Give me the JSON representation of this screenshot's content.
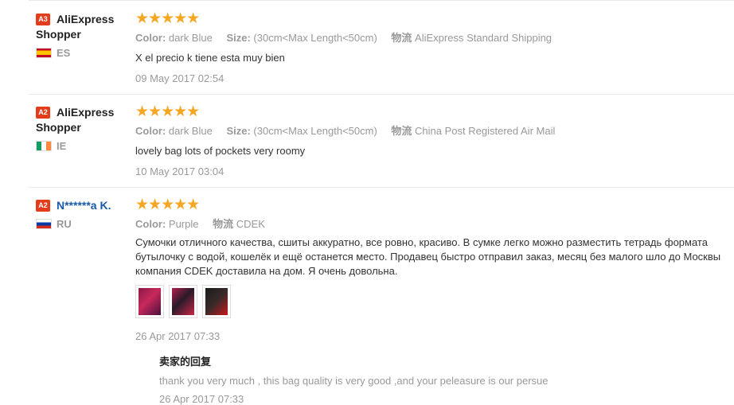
{
  "reviews": [
    {
      "level": "A3",
      "user_name": "AliExpress Shopper",
      "country_code": "ES",
      "stars": "★★★★★",
      "color_label": "Color:",
      "color_value": "dark Blue",
      "size_label": "Size:",
      "size_value": "(30cm<Max Length<50cm)",
      "logistics_label": "物流",
      "logistics_value": "AliExpress Standard Shipping",
      "text": "X el precio k tiene esta muy bien",
      "date": "09 May 2017 02:54"
    },
    {
      "level": "A2",
      "user_name": "AliExpress Shopper",
      "country_code": "IE",
      "stars": "★★★★★",
      "color_label": "Color:",
      "color_value": "dark Blue",
      "size_label": "Size:",
      "size_value": "(30cm<Max Length<50cm)",
      "logistics_label": "物流",
      "logistics_value": "China Post Registered Air Mail",
      "text": "lovely bag lots of pockets very roomy",
      "date": "10 May 2017 03:04"
    },
    {
      "level": "A2",
      "user_name": "N******a K.",
      "country_code": "RU",
      "stars": "★★★★★",
      "color_label": "Color:",
      "color_value": "Purple",
      "logistics_label": "物流",
      "logistics_value": "CDEK",
      "text_lines": [
        "Сумочки отличного качества, сшиты аккуратно, все ровно, красиво. В сумке легко можно разместить тетрадь формата",
        "бутылочку с водой, кошелёк и ещё останется место. Продавец быстро отправил заказ, месяц без малого шло до Москвы",
        "компания CDEK доставила на дом. Я очень довольна."
      ],
      "date": "26 Apr 2017 07:33",
      "reply": {
        "title": "卖家的回复",
        "text": "thank you very much , this bag quality is very good ,and your peleasure is our persue",
        "date": "26 Apr 2017 07:33"
      }
    }
  ]
}
